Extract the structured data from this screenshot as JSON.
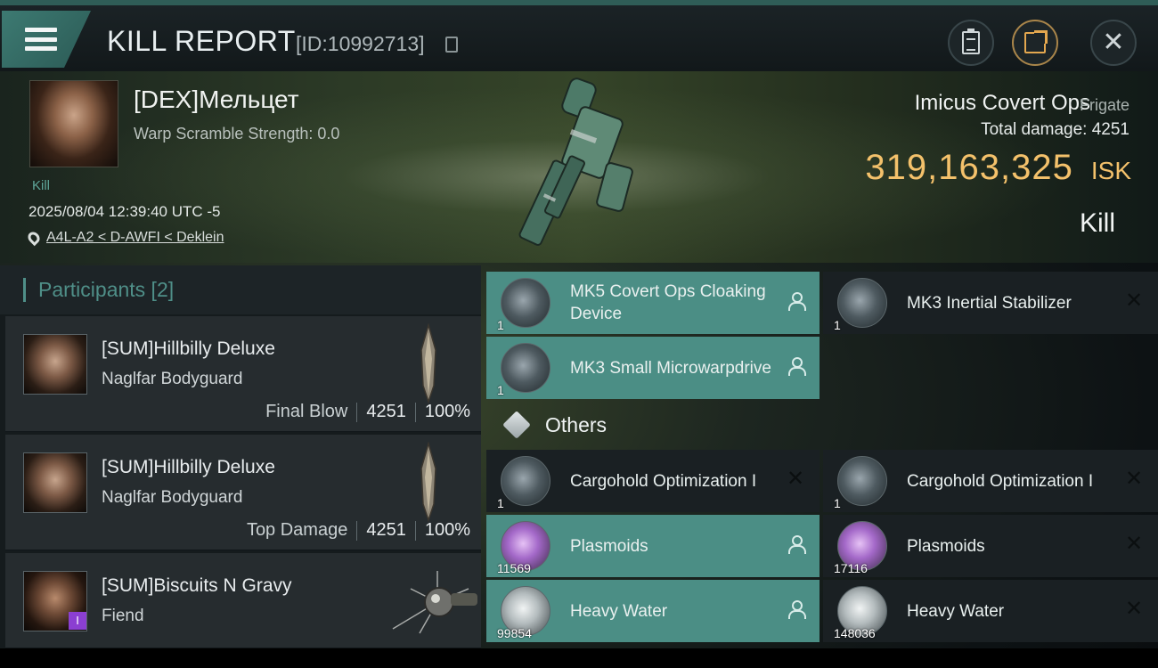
{
  "header": {
    "title": "KILL REPORT",
    "report_id": "[ID:10992713]"
  },
  "victim": {
    "name": "[DEX]Мельцет",
    "warp_scramble": "Warp Scramble Strength: 0.0",
    "tag": "Kill",
    "timestamp": "2025/08/04 12:39:40 UTC -5",
    "location": "A4L-A2 < D-AWFI < Deklein"
  },
  "ship": {
    "name": "Imicus Covert Ops",
    "class": "Frigate",
    "total_damage": "Total damage: 4251",
    "isk_value": "319,163,325",
    "isk_unit": "ISK",
    "result": "Kill"
  },
  "participants": {
    "title": "Participants [2]",
    "rows": [
      {
        "name": "[SUM]Hillbilly Deluxe",
        "ship": "Naglfar Bodyguard",
        "label": "Final Blow",
        "damage": "4251",
        "percent": "100%"
      },
      {
        "name": "[SUM]Hillbilly Deluxe",
        "ship": "Naglfar Bodyguard",
        "label": "Top Damage",
        "damage": "4251",
        "percent": "100%"
      },
      {
        "name": "[SUM]Biscuits N Gravy",
        "ship": "Fiend",
        "badge": "I"
      }
    ]
  },
  "modules": {
    "fitted": [
      {
        "name": "MK5 Covert Ops Cloaking Device",
        "qty": "1",
        "status": "dropped"
      },
      {
        "name": "MK3 Inertial Stabilizer",
        "qty": "1",
        "status": "destroyed"
      },
      {
        "name": "MK3 Small Microwarpdrive",
        "qty": "1",
        "status": "dropped"
      }
    ],
    "others_title": "Others",
    "others": [
      {
        "name": "Cargohold Optimization I",
        "qty": "1",
        "status": "destroyed"
      },
      {
        "name": "Cargohold Optimization I",
        "qty": "1",
        "status": "destroyed"
      },
      {
        "name": "Plasmoids",
        "qty": "11569",
        "status": "dropped"
      },
      {
        "name": "Plasmoids",
        "qty": "17116",
        "status": "destroyed"
      },
      {
        "name": "Heavy Water",
        "qty": "99854",
        "status": "dropped"
      },
      {
        "name": "Heavy Water",
        "qty": "148036",
        "status": "destroyed"
      }
    ]
  },
  "colors": {
    "accent": "#4b8e85",
    "isk": "#f4c16b",
    "badge": "#8b3fd1"
  }
}
